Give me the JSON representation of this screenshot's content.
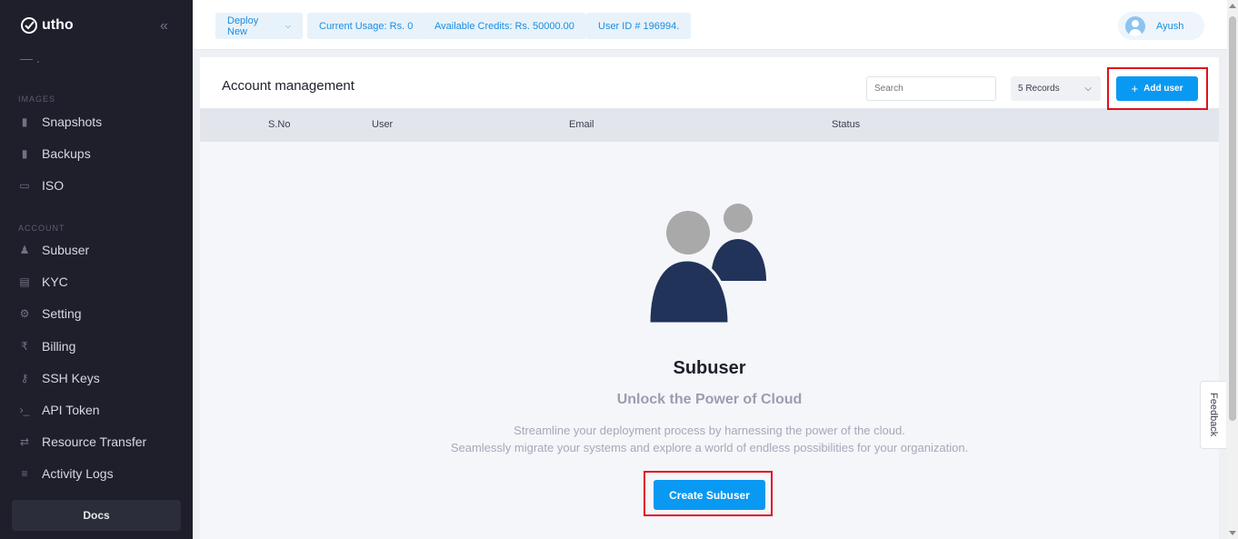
{
  "colors": {
    "accent": "#0a99f2",
    "sidebar_bg": "#1e1f2b",
    "highlight": "#e0101a",
    "illustration_dark": "#213359",
    "illustration_grey": "#a9a9a9"
  },
  "brand": {
    "name": "utho"
  },
  "sidebar": {
    "sections": {
      "images": "IMAGES",
      "account": "ACCOUNT"
    },
    "items": [
      {
        "label": "Snapshots",
        "icon": "snapshot-icon"
      },
      {
        "label": "Backups",
        "icon": "backup-icon"
      },
      {
        "label": "ISO",
        "icon": "iso-icon"
      },
      {
        "label": "Subuser",
        "icon": "subuser-icon"
      },
      {
        "label": "KYC",
        "icon": "kyc-icon"
      },
      {
        "label": "Setting",
        "icon": "gear-icon"
      },
      {
        "label": "Billing",
        "icon": "rupee-icon"
      },
      {
        "label": "SSH Keys",
        "icon": "key-icon"
      },
      {
        "label": "API Token",
        "icon": "terminal-icon"
      },
      {
        "label": "Resource Transfer",
        "icon": "transfer-icon"
      },
      {
        "label": "Activity Logs",
        "icon": "logs-icon"
      }
    ],
    "docs_label": "Docs"
  },
  "topbar": {
    "deploy_label": "Deploy New",
    "current_usage": "Current Usage: Rs. 0",
    "available_credits": "Available Credits: Rs. 50000.00",
    "user_id": "User ID # 196994.",
    "user_name": "Ayush"
  },
  "main": {
    "title": "Account management",
    "search_placeholder": "Search",
    "records_label": "5 Records",
    "add_user_label": "Add user",
    "columns": [
      "S.No",
      "User",
      "Email",
      "Status"
    ],
    "empty": {
      "title": "Subuser",
      "subtitle": "Unlock the Power of Cloud",
      "desc_line1": "Streamline your deployment process by harnessing the power of the cloud.",
      "desc_line2": "Seamlessly migrate your systems and explore a world of endless possibilities for your organization.",
      "button_label": "Create Subuser"
    }
  },
  "feedback_label": "Feedback"
}
